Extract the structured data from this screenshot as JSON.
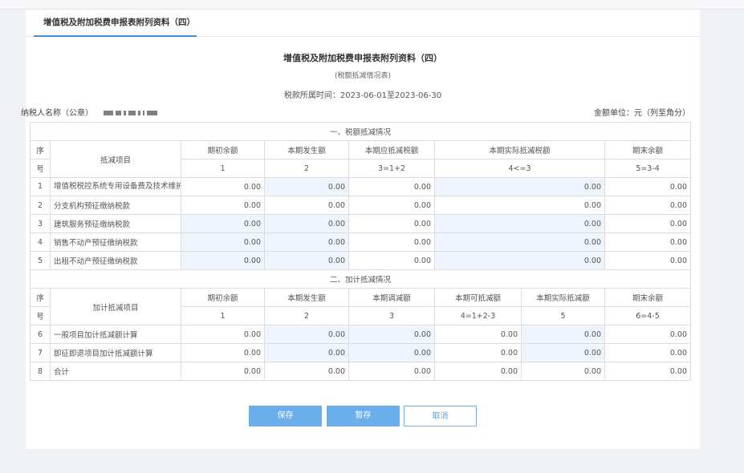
{
  "tab": {
    "label": "增值税及附加税费申报表附列资料（四）"
  },
  "header": {
    "title": "增值税及附加税费申报表附列资料（四）",
    "subtitle": "(税额抵减情况表)",
    "period": "税款所属时间：2023-06-01至2023-06-30",
    "taxpayer_label": "纳税人名称（公章）",
    "unit": "金额单位：元（列至角分）"
  },
  "section1": {
    "title": "一、税额抵减情况",
    "seq_header_1": "序",
    "seq_header_2": "号",
    "item_header": "抵减项目",
    "columns": [
      "期初余额",
      "本期发生额",
      "本期应抵减税额",
      "本期实际抵减税额",
      "期末余额"
    ],
    "column_codes": [
      "1",
      "2",
      "3=1+2",
      "4<=3",
      "5=3-4"
    ],
    "rows": [
      {
        "no": "1",
        "name": "增值税税控系统专用设备费及技术维护费",
        "values": [
          "0.00",
          "0.00",
          "0.00",
          "0.00",
          "0.00"
        ]
      },
      {
        "no": "2",
        "name": "分支机构预征缴纳税款",
        "values": [
          "0.00",
          "0.00",
          "0.00",
          "0.00",
          "0.00"
        ]
      },
      {
        "no": "3",
        "name": "建筑服务预征缴纳税款",
        "values": [
          "0.00",
          "0.00",
          "0.00",
          "0.00",
          "0.00"
        ]
      },
      {
        "no": "4",
        "name": "销售不动产预征缴纳税款",
        "values": [
          "0.00",
          "0.00",
          "0.00",
          "0.00",
          "0.00"
        ]
      },
      {
        "no": "5",
        "name": "出租不动产预征缴纳税款",
        "values": [
          "0.00",
          "0.00",
          "0.00",
          "0.00",
          "0.00"
        ]
      }
    ]
  },
  "section2": {
    "title": "二、加计抵减情况",
    "seq_header_1": "序",
    "seq_header_2": "号",
    "item_header": "加计抵减项目",
    "columns": [
      "期初余额",
      "本期发生额",
      "本期调减额",
      "本期可抵减额",
      "本期实际抵减额",
      "期末余额"
    ],
    "column_codes": [
      "1",
      "2",
      "3",
      "4=1+2-3",
      "5",
      "6=4-5"
    ],
    "rows": [
      {
        "no": "6",
        "name": "一般项目加计抵减额计算",
        "values": [
          "0.00",
          "0.00",
          "0.00",
          "0.00",
          "0.00",
          "0.00"
        ]
      },
      {
        "no": "7",
        "name": "即征即退项目加计抵减额计算",
        "values": [
          "0.00",
          "0.00",
          "0.00",
          "0.00",
          "0.00",
          "0.00"
        ]
      },
      {
        "no": "8",
        "name": "合计",
        "values": [
          "0.00",
          "0.00",
          "0.00",
          "0.00",
          "0.00",
          "0.00"
        ]
      }
    ]
  },
  "buttons": {
    "save": "保存",
    "draft": "暂存",
    "cancel": "取消"
  },
  "colors": {
    "accent": "#3d8fd8",
    "editable_bg": "#eef5fd",
    "editable_text": "#3a8ee6",
    "button": "#6aaeea"
  }
}
